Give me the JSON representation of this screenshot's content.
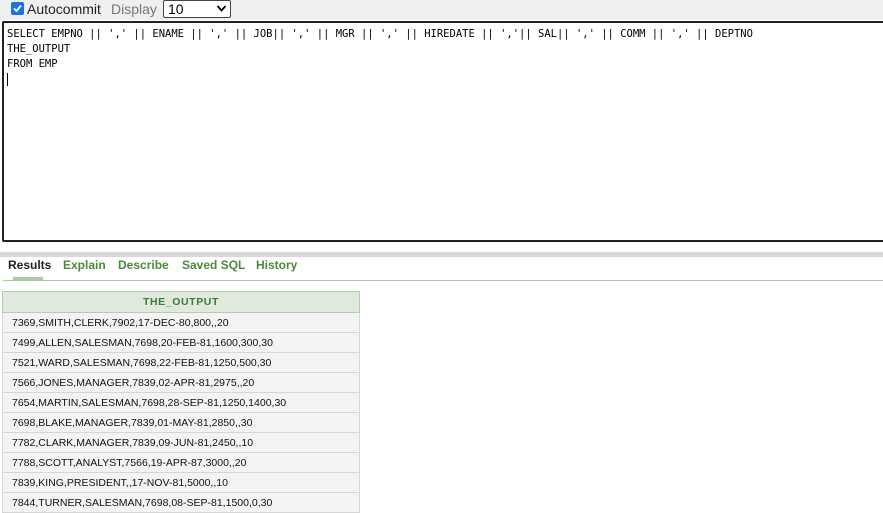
{
  "toolbar": {
    "autocommit_label": "Autocommit",
    "autocommit_checked": true,
    "display_label": "Display",
    "display_value": "10"
  },
  "editor": {
    "lines": [
      "SELECT EMPNO || ',' || ENAME || ',' || JOB|| ',' || MGR || ',' || HIREDATE || ','|| SAL|| ',' || COMM || ',' || DEPTNO",
      "THE_OUTPUT",
      "FROM EMP"
    ]
  },
  "tabs": [
    {
      "label": "Results",
      "active": true
    },
    {
      "label": "Explain",
      "active": false
    },
    {
      "label": "Describe",
      "active": false
    },
    {
      "label": "Saved SQL",
      "active": false
    },
    {
      "label": "History",
      "active": false
    }
  ],
  "results": {
    "column": "THE_OUTPUT",
    "rows": [
      "7369,SMITH,CLERK,7902,17-DEC-80,800,,20",
      "7499,ALLEN,SALESMAN,7698,20-FEB-81,1600,300,30",
      "7521,WARD,SALESMAN,7698,22-FEB-81,1250,500,30",
      "7566,JONES,MANAGER,7839,02-APR-81,2975,,20",
      "7654,MARTIN,SALESMAN,7698,28-SEP-81,1250,1400,30",
      "7698,BLAKE,MANAGER,7839,01-MAY-81,2850,,30",
      "7782,CLARK,MANAGER,7839,09-JUN-81,2450,,10",
      "7788,SCOTT,ANALYST,7566,19-APR-87,3000,,20",
      "7839,KING,PRESIDENT,,17-NOV-81,5000,,10",
      "7844,TURNER,SALESMAN,7698,08-SEP-81,1500,0,30"
    ]
  },
  "colors": {
    "tab_inactive": "#4a8a3a",
    "header_bg": "#dfe9dc",
    "header_text": "#3a7a3a",
    "checkbox_accent": "#1a73e8"
  },
  "icons": {
    "checkbox": "check-icon",
    "select": "chevron-down-icon"
  }
}
